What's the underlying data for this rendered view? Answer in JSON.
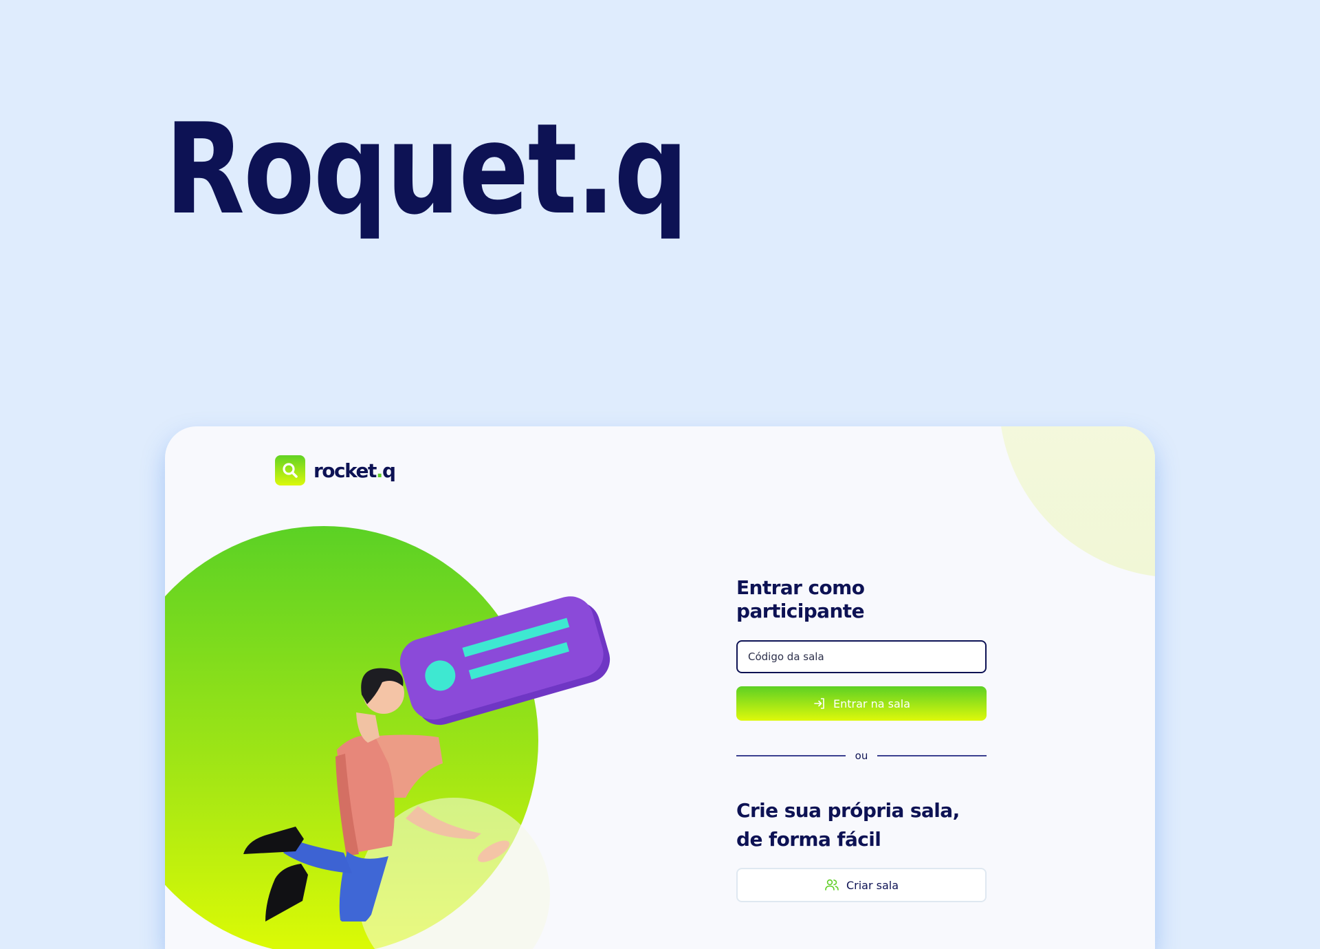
{
  "page": {
    "title": "Roquet.q"
  },
  "app": {
    "brand": {
      "name_main": "rocket",
      "name_dot": ".",
      "name_suffix": "q",
      "logo_icon": "search-icon"
    },
    "participant": {
      "heading": "Entrar como participante",
      "room_code_placeholder": "Código da sala",
      "room_code_value": "",
      "enter_button_label": "Entrar na sala",
      "enter_button_icon": "log-in-icon"
    },
    "divider_label": "ou",
    "create": {
      "heading": "Crie sua própria sala, de forma fácil",
      "button_label": "Criar sala",
      "button_icon": "users-icon"
    }
  },
  "colors": {
    "background": "#dfecfd",
    "navy": "#0d1254",
    "green": "#5fcf24",
    "lime": "#ddf90b",
    "purple": "#8b4ad9",
    "cyan": "#3ee8d1"
  }
}
